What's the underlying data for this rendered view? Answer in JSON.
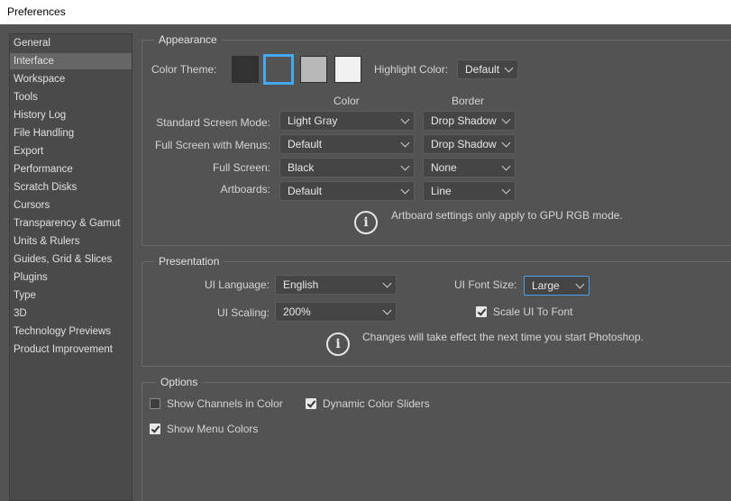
{
  "window": {
    "title": "Preferences"
  },
  "sidebar": {
    "items": [
      {
        "label": "General"
      },
      {
        "label": "Interface"
      },
      {
        "label": "Workspace"
      },
      {
        "label": "Tools"
      },
      {
        "label": "History Log"
      },
      {
        "label": "File Handling"
      },
      {
        "label": "Export"
      },
      {
        "label": "Performance"
      },
      {
        "label": "Scratch Disks"
      },
      {
        "label": "Cursors"
      },
      {
        "label": "Transparency & Gamut"
      },
      {
        "label": "Units & Rulers"
      },
      {
        "label": "Guides, Grid & Slices"
      },
      {
        "label": "Plugins"
      },
      {
        "label": "Type"
      },
      {
        "label": "3D"
      },
      {
        "label": "Technology Previews"
      },
      {
        "label": "Product Improvement"
      }
    ],
    "selected": "Interface"
  },
  "appearance": {
    "title": "Appearance",
    "color_theme_label": "Color Theme:",
    "themes": [
      {
        "name": "darkest",
        "color": "#323232"
      },
      {
        "name": "dark",
        "color": "#535353",
        "selected": true
      },
      {
        "name": "medium-gray",
        "color": "#b8b8b8"
      },
      {
        "name": "light-gray",
        "color": "#f0f0f0"
      }
    ],
    "highlight_label": "Highlight Color:",
    "highlight_value": "Default",
    "col_color": "Color",
    "col_border": "Border",
    "rows": {
      "standard": {
        "label": "Standard Screen Mode:",
        "color": "Light Gray",
        "border": "Drop Shadow"
      },
      "fullmenus": {
        "label": "Full Screen with Menus:",
        "color": "Default",
        "border": "Drop Shadow"
      },
      "fullscreen": {
        "label": "Full Screen:",
        "color": "Black",
        "border": "None"
      },
      "artboards": {
        "label": "Artboards:",
        "color": "Default",
        "border": "Line"
      }
    },
    "info": "Artboard settings only apply to GPU RGB mode."
  },
  "presentation": {
    "title": "Presentation",
    "language_label": "UI Language:",
    "language_value": "English",
    "font_size_label": "UI Font Size:",
    "font_size_value": "Large",
    "scaling_label": "UI Scaling:",
    "scaling_value": "200%",
    "scale_font_label": "Scale UI To Font",
    "scale_font_checked": true,
    "info": "Changes will take effect the next time you start Photoshop."
  },
  "options": {
    "title": "Options",
    "show_channels_label": "Show Channels in Color",
    "show_channels_checked": false,
    "dynamic_sliders_label": "Dynamic Color Sliders",
    "dynamic_sliders_checked": true,
    "show_menu_colors_label": "Show Menu Colors",
    "show_menu_colors_checked": true
  }
}
